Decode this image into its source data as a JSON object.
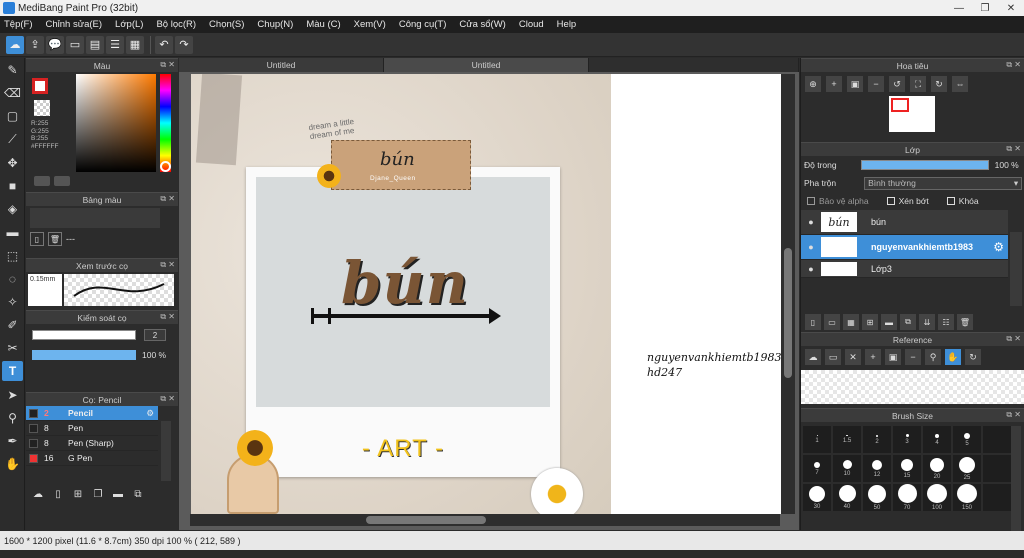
{
  "window": {
    "title": "MediBang Paint Pro (32bit)"
  },
  "menu": [
    "Tệp(F)",
    "Chỉnh sửa(E)",
    "Lớp(L)",
    "Bộ lọc(R)",
    "Chọn(S)",
    "Chụp(N)",
    "Màu (C)",
    "Xem(V)",
    "Công cụ(T)",
    "Cửa sổ(W)",
    "Cloud",
    "Help"
  ],
  "panels": {
    "color": {
      "title": "Màu",
      "rgb": "R:255\nG:255\nB:255\n#FFFFFF",
      "fg": "#ffffff",
      "accent": "#d62222"
    },
    "palette": {
      "title": "Bảng màu",
      "placeholder": "---"
    },
    "preview": {
      "title": "Xem trước cọ",
      "size": "0.15mm"
    },
    "control": {
      "title": "Kiểm soát cọ",
      "size_value": "2",
      "opacity": "100 %"
    },
    "brushes": {
      "title": "Cọ: Pencil",
      "items": [
        {
          "size": "2",
          "name": "Pencil",
          "selected": true
        },
        {
          "size": "8",
          "name": "Pen"
        },
        {
          "size": "8",
          "name": "Pen (Sharp)"
        },
        {
          "size": "16",
          "name": "G Pen"
        }
      ]
    },
    "navigator": {
      "title": "Hoa tiêu"
    },
    "layers": {
      "title": "Lớp",
      "opacity_label": "Độ trong",
      "opacity_value": "100 %",
      "blend_label": "Pha trộn",
      "blend_value": "Bình thường",
      "protect_alpha": "Bảo vệ alpha",
      "clipping": "Xén bớt",
      "lock": "Khóa",
      "items": [
        {
          "name": "bún",
          "thumb": "bún"
        },
        {
          "name": "nguyenvankhiemtb1983",
          "thumb": "",
          "selected": true
        },
        {
          "name": "Lớp3",
          "thumb": ""
        }
      ]
    },
    "reference": {
      "title": "Reference"
    },
    "brush_size": {
      "title": "Brush Size",
      "sizes": [
        "1",
        "1.5",
        "2",
        "3",
        "4",
        "5",
        "",
        "7",
        "10",
        "12",
        "15",
        "20",
        "25",
        "",
        "30",
        "40",
        "50",
        "70",
        "100",
        "150",
        ""
      ]
    }
  },
  "tabs": [
    "Untitled",
    "Untitled"
  ],
  "canvas": {
    "sticker_word": "bún",
    "sticker_caption": "Djane_Queen",
    "dream": "dream a little\ndream of me",
    "main_word": "bún",
    "art": "- ART -",
    "watermark_line1": "nguyenvankhiemtb1983",
    "watermark_line2": "hd247"
  },
  "status": {
    "text": "1600 * 1200 pixel  (11.6 * 8.7cm)  350 dpi  100 %  ( 212, 589 )"
  }
}
